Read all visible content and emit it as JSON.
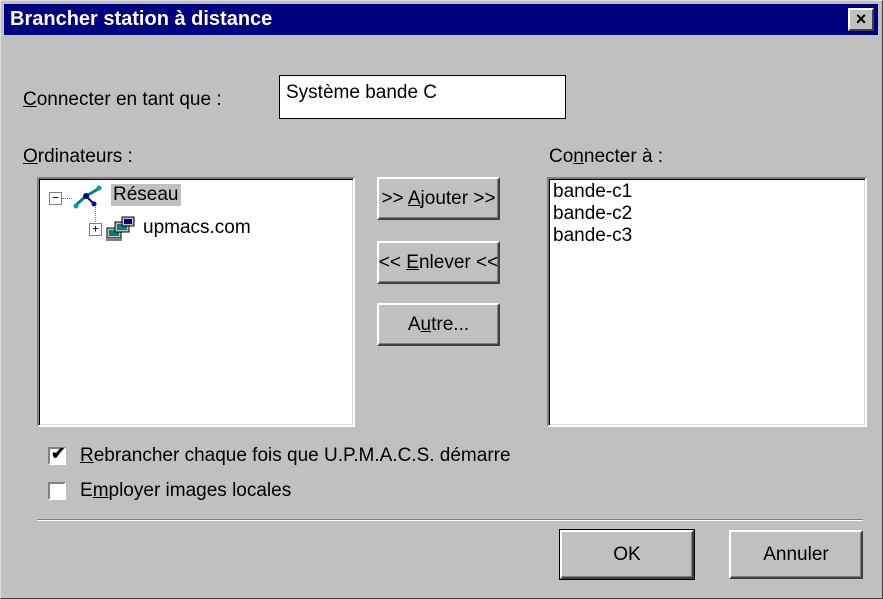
{
  "window": {
    "title": "Brancher station à distance",
    "close_label": "×"
  },
  "connect_as": {
    "label_prefix": "",
    "label_underlined": "C",
    "label_rest": "onnecter en tant que :",
    "value": "Système bande C"
  },
  "computers": {
    "label_underlined": "O",
    "label_rest": "rdinateurs :",
    "tree": [
      {
        "label": "Réseau",
        "expander": "−",
        "icon": "network-icon"
      },
      {
        "label": "upmacs.com",
        "expander": "+",
        "icon": "domain-computers-icon"
      }
    ]
  },
  "buttons": {
    "add_prefix": ">> ",
    "add_u": "A",
    "add_rest": "jouter >>",
    "remove_prefix": "<< ",
    "remove_u": "E",
    "remove_rest": "nlever <<",
    "other_prefix": "A",
    "other_u": "u",
    "other_rest": "tre...",
    "ok": "OK",
    "cancel": "Annuler"
  },
  "connect_to": {
    "label_prefix": "Co",
    "label_u": "n",
    "label_rest": "necter à :",
    "items": [
      "bande-c1",
      "bande-c2",
      "bande-c3"
    ]
  },
  "options": {
    "reconnect": {
      "u": "R",
      "rest": "ebrancher chaque fois que U.P.M.A.C.S. démarre",
      "checked": true,
      "mark": "✔"
    },
    "local_images": {
      "prefix": "E",
      "u": "m",
      "rest": "ployer images locales",
      "checked": false
    }
  }
}
